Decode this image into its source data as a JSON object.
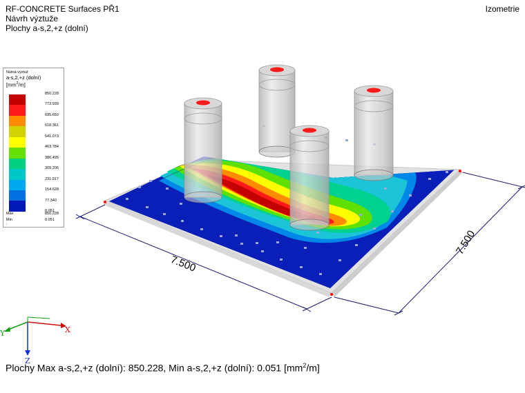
{
  "header": {
    "title": "RF-CONCRETE Surfaces PŘ1",
    "subtitle": "Návrh výztuže",
    "result": "Plochy a-s,2,+z (dolní)",
    "view": "Izometrie"
  },
  "legend": {
    "caption": "Nutná výztuž",
    "quantity": "a-s,2,+z (dolní)",
    "unit_prefix": "[mm",
    "unit_exp": "2",
    "unit_suffix": "/m]",
    "values": [
      "850.228",
      "772.939",
      "695.650",
      "618.361",
      "541.073",
      "463.784",
      "386.495",
      "309.206",
      "231.917",
      "154.628",
      "77.340",
      "0.051"
    ],
    "colors": [
      "#c40000",
      "#ff1a1a",
      "#ff8c00",
      "#d2d200",
      "#ffff00",
      "#66e000",
      "#00d080",
      "#00c8c8",
      "#00a8f0",
      "#0070e0",
      "#0018b8"
    ],
    "max_label": "Max :",
    "max_value": "850.228",
    "min_label": "Min :",
    "min_value": "0.051"
  },
  "dimensions": {
    "front": "7.500",
    "right": "7.500"
  },
  "axes": {
    "x": "X",
    "y": "Y",
    "z": "Z"
  },
  "footer": {
    "text": "Plochy Max a-s,2,+z (dolní): 850.228, Min a-s,2,+z (dolní): 0.051 [mm",
    "exp": "2",
    "suffix": "/m]"
  }
}
